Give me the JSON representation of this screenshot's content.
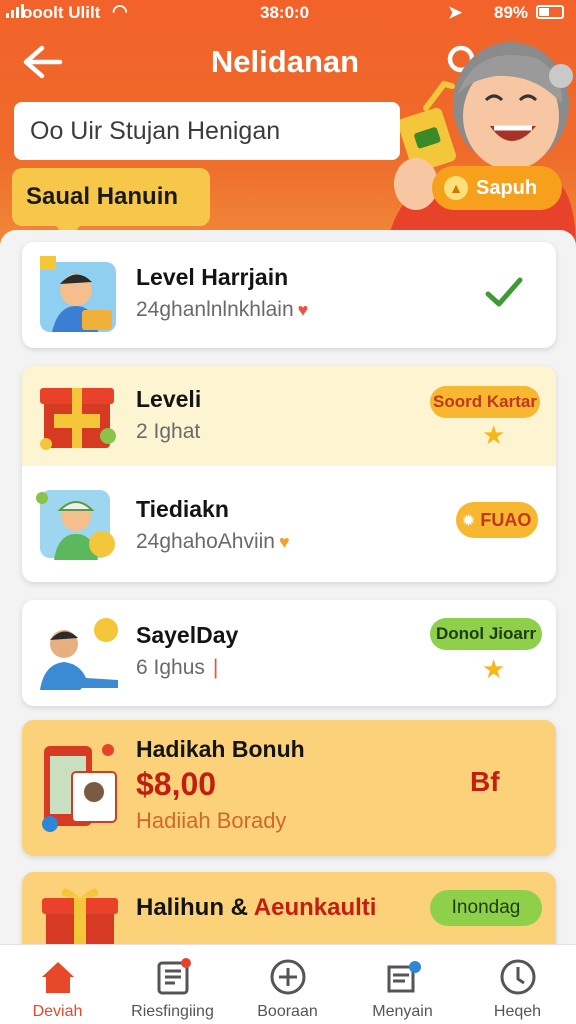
{
  "status_bar": {
    "carrier": "ooolt Ulilt",
    "time": "38:0:0",
    "battery": "89%"
  },
  "header": {
    "title": "Nelidanan",
    "search_placeholder": "Oo Uir Stujan Henigan",
    "section_tab": "Saual Hanuin",
    "action_button": "Sapuh",
    "colors": {
      "primary": "#f2622a",
      "accent": "#f7c74a"
    }
  },
  "levels": [
    {
      "title": "Level Harrjain",
      "subtitle": "24ghanlnlnkhlain",
      "status": "check-icon"
    },
    {
      "title": "Leveli",
      "subtitle": "2 Ighat",
      "badge": "Soord Kartar"
    },
    {
      "title": "Tiediakn",
      "subtitle": "24ghahoAhviin",
      "badge": "FUAO"
    },
    {
      "title": "SayelDay",
      "subtitle": "6 Ighus",
      "badge": "Donol Jioarr"
    }
  ],
  "bonus": {
    "title": "Hadikah Bonuh",
    "amount": "$8,00",
    "subtitle": "Hadiiah Borady",
    "tag": "Bf"
  },
  "last_card": {
    "title_a": "Halihun &",
    "title_b": "Aeunkaulti",
    "badge": "Inondag"
  },
  "nav": [
    {
      "label": "Deviah",
      "icon": "home-icon"
    },
    {
      "label": "Riesfingiing",
      "icon": "document-icon"
    },
    {
      "label": "Booraan",
      "icon": "plus-circle-icon"
    },
    {
      "label": "Menyain",
      "icon": "inbox-icon"
    },
    {
      "label": "Heqeh",
      "icon": "help-icon"
    }
  ]
}
